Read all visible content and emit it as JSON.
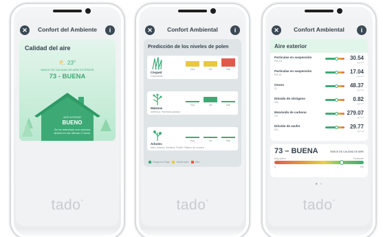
{
  "brand": {
    "wordmark": "tado",
    "mark": "°"
  },
  "header_icons": {
    "left": "close-icon",
    "right": "info-icon"
  },
  "phones": [
    {
      "header_title": "Confort del Ambiente",
      "card_title": "Calidad del aire",
      "outdoor_temp": "23°",
      "index_label": "INDICE DE CALIDAD DE AIRE EXTERIOR",
      "index_value": "73 - BUENA",
      "indoor_label": "AIRE INTERIOR",
      "indoor_value": "BUENO",
      "indoor_message": "Se ha detectado una ventana abierta en las últimas 2 horas."
    },
    {
      "header_title": "Confort Ambiental",
      "card_title": "Predicción de los niveles de polen",
      "columns": [
        "Hoy",
        "Vie",
        "Sab"
      ],
      "rows": [
        {
          "name": "Césped",
          "sub": "Gramíneas",
          "levels": [
            2,
            2,
            3
          ]
        },
        {
          "name": "Malezas",
          "sub": "Artemisa, Parietaria judaica",
          "levels": [
            1,
            2,
            1
          ]
        },
        {
          "name": "Árboles",
          "sub": "Aliso, Abedul, Avellano, Roble, Plátano de sombra",
          "levels": [
            1,
            1,
            1
          ]
        }
      ],
      "legend": [
        "Ninguno/ Bajo",
        "Moderado",
        "Alto"
      ]
    },
    {
      "header_title": "Confort Ambiental",
      "card_title": "Aire exterior",
      "pollutants": [
        {
          "name": "Particulas en suspensión",
          "sub": "PM 2.5",
          "value": "30.54",
          "unit": "µg / m³"
        },
        {
          "name": "Partículas en suspensión",
          "sub": "PM 10",
          "value": "17.04",
          "unit": "µg / m³"
        },
        {
          "name": "Ozono",
          "sub": "O₃",
          "value": "48.37",
          "unit": "µg / m³"
        },
        {
          "name": "Dióxido de nitrógeno",
          "sub": "NO₂",
          "value": "0.82",
          "unit": "µg / m³"
        },
        {
          "name": "Monóxido de carbono",
          "sub": "CO",
          "value": "279.07",
          "unit": "µg / m³"
        },
        {
          "name": "Dióxido de azufre",
          "sub": "SO₂",
          "value": "29.77",
          "unit": "µg / m³"
        }
      ],
      "aqi": {
        "value": "73 – BUENA",
        "label": "ÍNDICE DE CALIDAD DE AIRE",
        "poor": "Muy pobre",
        "excellent": "Excelente",
        "min": "0",
        "max": "100",
        "level": 0.73
      }
    }
  ],
  "colors": {
    "accent": "#3daa75",
    "low": "#3daa75",
    "moderate": "#e8c93c",
    "high": "#e05a4c",
    "text": "#37434e"
  }
}
